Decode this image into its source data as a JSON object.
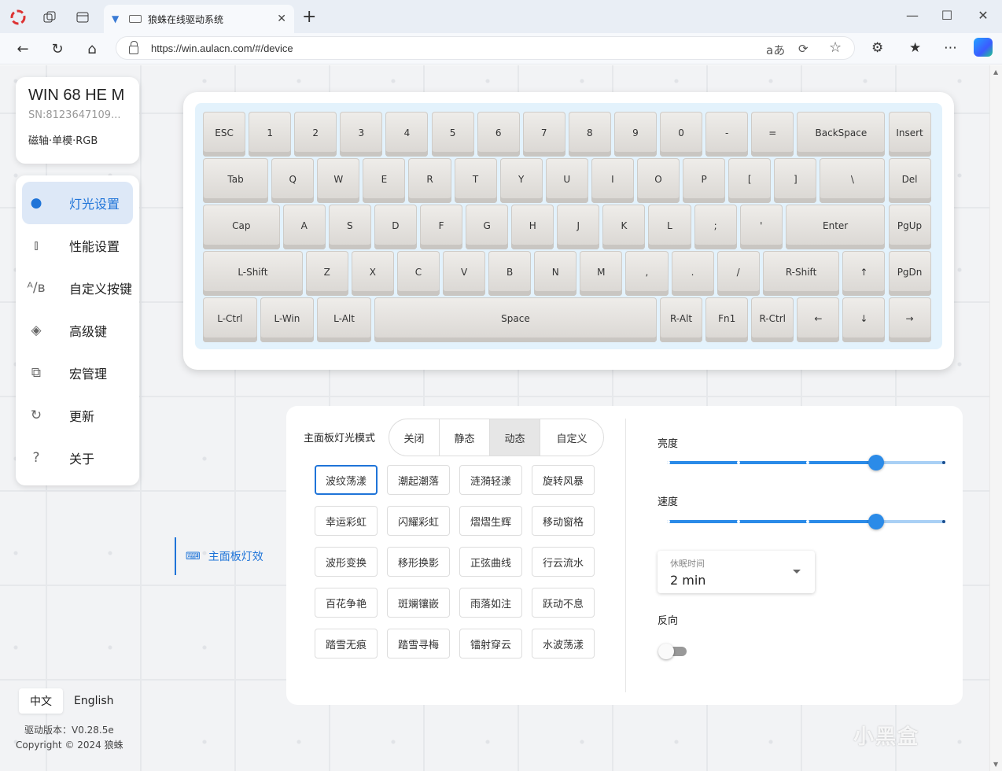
{
  "browser": {
    "tab_title": "狼蛛在线驱动系统",
    "tab_close": "✕",
    "new_tab": "+",
    "url": "https://win.aulacn.com/#/device",
    "window_controls": {
      "minimize": "—",
      "maximize": "☐",
      "close": "✕"
    },
    "nav": {
      "back": "←",
      "refresh": "↻",
      "home": "⌂"
    },
    "addr_icons": {
      "read_aloud": "aあ",
      "sync": "⟳",
      "favorite": "☆"
    },
    "toolbar_icons": {
      "extensions": "⚙",
      "favorites": "★",
      "more": "⋯"
    }
  },
  "device": {
    "name": "WIN 68 HE M",
    "sn": "SN:8123647109...",
    "config": "磁轴·单模·RGB"
  },
  "menu": [
    {
      "label": "灯光设置",
      "icon": "●",
      "icon_name": "bulb-icon",
      "active": true
    },
    {
      "label": "性能设置",
      "icon": "⫾",
      "icon_name": "bars-icon",
      "active": false
    },
    {
      "label": "自定义按键",
      "icon": "ᴬ/ʙ",
      "icon_name": "ab-icon",
      "active": false
    },
    {
      "label": "高级键",
      "icon": "◈",
      "icon_name": "advanced-key-icon",
      "active": false
    },
    {
      "label": "宏管理",
      "icon": "⧉",
      "icon_name": "macro-icon",
      "active": false
    },
    {
      "label": "更新",
      "icon": "↻",
      "icon_name": "update-icon",
      "active": false
    },
    {
      "label": "关于",
      "icon": "?",
      "icon_name": "question-icon",
      "active": false
    }
  ],
  "sub_nav": {
    "label": "主面板灯效",
    "icon": "⌨"
  },
  "language": {
    "zh": "中文",
    "en": "English"
  },
  "footer": {
    "version": "驱动版本：V0.28.5e",
    "copyright": "Copyright © 2024 狼蛛"
  },
  "keyboard": {
    "rows": [
      [
        {
          "l": "ESC",
          "w": 1
        },
        {
          "l": "1",
          "w": 1
        },
        {
          "l": "2",
          "w": 1
        },
        {
          "l": "3",
          "w": 1
        },
        {
          "l": "4",
          "w": 1
        },
        {
          "l": "5",
          "w": 1
        },
        {
          "l": "6",
          "w": 1
        },
        {
          "l": "7",
          "w": 1
        },
        {
          "l": "8",
          "w": 1
        },
        {
          "l": "9",
          "w": 1
        },
        {
          "l": "0",
          "w": 1
        },
        {
          "l": "-",
          "w": 1
        },
        {
          "l": "=",
          "w": 1
        },
        {
          "l": "BackSpace",
          "w": 2
        },
        {
          "l": "Insert",
          "w": 1
        }
      ],
      [
        {
          "l": "Tab",
          "w": 1.5
        },
        {
          "l": "Q",
          "w": 1
        },
        {
          "l": "W",
          "w": 1
        },
        {
          "l": "E",
          "w": 1
        },
        {
          "l": "R",
          "w": 1
        },
        {
          "l": "T",
          "w": 1
        },
        {
          "l": "Y",
          "w": 1
        },
        {
          "l": "U",
          "w": 1
        },
        {
          "l": "I",
          "w": 1
        },
        {
          "l": "O",
          "w": 1
        },
        {
          "l": "P",
          "w": 1
        },
        {
          "l": "[",
          "w": 1
        },
        {
          "l": "]",
          "w": 1
        },
        {
          "l": "\\",
          "w": 1.5
        },
        {
          "l": "Del",
          "w": 1
        }
      ],
      [
        {
          "l": "Cap",
          "w": 1.75
        },
        {
          "l": "A",
          "w": 1
        },
        {
          "l": "S",
          "w": 1
        },
        {
          "l": "D",
          "w": 1
        },
        {
          "l": "F",
          "w": 1
        },
        {
          "l": "G",
          "w": 1
        },
        {
          "l": "H",
          "w": 1
        },
        {
          "l": "J",
          "w": 1
        },
        {
          "l": "K",
          "w": 1
        },
        {
          "l": "L",
          "w": 1
        },
        {
          "l": ";",
          "w": 1
        },
        {
          "l": "'",
          "w": 1
        },
        {
          "l": "Enter",
          "w": 2.25
        },
        {
          "l": "PgUp",
          "w": 1
        }
      ],
      [
        {
          "l": "L-Shift",
          "w": 2.25
        },
        {
          "l": "Z",
          "w": 1
        },
        {
          "l": "X",
          "w": 1
        },
        {
          "l": "C",
          "w": 1
        },
        {
          "l": "V",
          "w": 1
        },
        {
          "l": "B",
          "w": 1
        },
        {
          "l": "N",
          "w": 1
        },
        {
          "l": "M",
          "w": 1
        },
        {
          "l": ",",
          "w": 1
        },
        {
          "l": ".",
          "w": 1
        },
        {
          "l": "/",
          "w": 1
        },
        {
          "l": "R-Shift",
          "w": 1.75
        },
        {
          "l": "↑",
          "w": 1
        },
        {
          "l": "PgDn",
          "w": 1
        }
      ],
      [
        {
          "l": "L-Ctrl",
          "w": 1.25
        },
        {
          "l": "L-Win",
          "w": 1.25
        },
        {
          "l": "L-Alt",
          "w": 1.25
        },
        {
          "l": "Space",
          "w": 6.25
        },
        {
          "l": "R-Alt",
          "w": 1
        },
        {
          "l": "Fn1",
          "w": 1
        },
        {
          "l": "R-Ctrl",
          "w": 1
        },
        {
          "l": "←",
          "w": 1
        },
        {
          "l": "↓",
          "w": 1
        },
        {
          "l": "→",
          "w": 1
        }
      ]
    ]
  },
  "lighting": {
    "mode_label": "主面板灯光模式",
    "modes": [
      "关闭",
      "静态",
      "动态",
      "自定义"
    ],
    "active_mode": 2,
    "effects": [
      "波纹荡漾",
      "潮起潮落",
      "涟漪轻漾",
      "旋转风暴",
      "幸运彩虹",
      "闪耀彩虹",
      "熠熠生辉",
      "移动窗格",
      "波形变换",
      "移形换影",
      "正弦曲线",
      "行云流水",
      "百花争艳",
      "斑斓镶嵌",
      "雨落如注",
      "跃动不息",
      "踏雪无痕",
      "踏雪寻梅",
      "镭射穿云",
      "水波荡漾"
    ],
    "active_effect": 0,
    "brightness": {
      "label": "亮度",
      "value": 0.75
    },
    "speed": {
      "label": "速度",
      "value": 0.75
    },
    "sleep": {
      "label": "休眠时间",
      "value": "2 min"
    },
    "reverse": {
      "label": "反向",
      "on": false
    }
  },
  "watermark": "小黑盒"
}
